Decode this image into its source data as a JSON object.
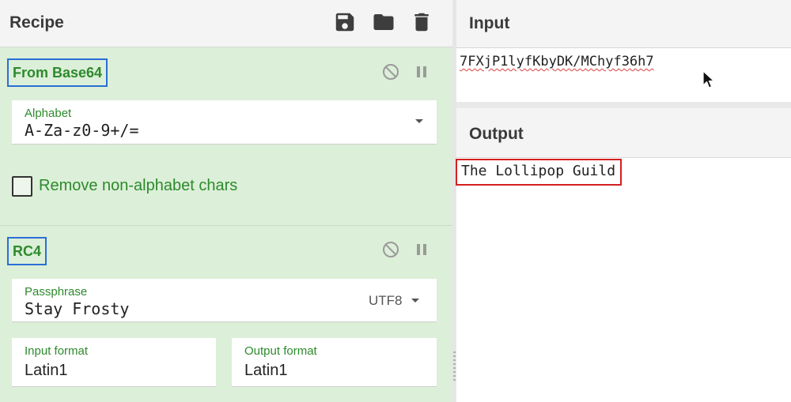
{
  "recipe": {
    "title": "Recipe",
    "icons": [
      "save-icon",
      "folder-icon",
      "trash-icon"
    ]
  },
  "operations": [
    {
      "name": "From Base64",
      "alphabet_label": "Alphabet",
      "alphabet_value": "A-Za-z0-9+/=",
      "checkbox_label": "Remove non-alphabet chars",
      "checkbox_checked": false
    },
    {
      "name": "RC4",
      "passphrase_label": "Passphrase",
      "passphrase_value": "Stay Frosty",
      "passphrase_encoding": "UTF8",
      "input_format_label": "Input format",
      "input_format_value": "Latin1",
      "output_format_label": "Output format",
      "output_format_value": "Latin1"
    }
  ],
  "input": {
    "title": "Input",
    "value": "7FXjP1lyfKbyDK/MChyf36h7"
  },
  "output": {
    "title": "Output",
    "value": "The Lollipop Guild"
  },
  "colors": {
    "recipe_background": "#dcefd8",
    "operation_text": "#2d8a2d",
    "operation_highlight": "#2a6fd6",
    "output_highlight": "#d42020"
  }
}
